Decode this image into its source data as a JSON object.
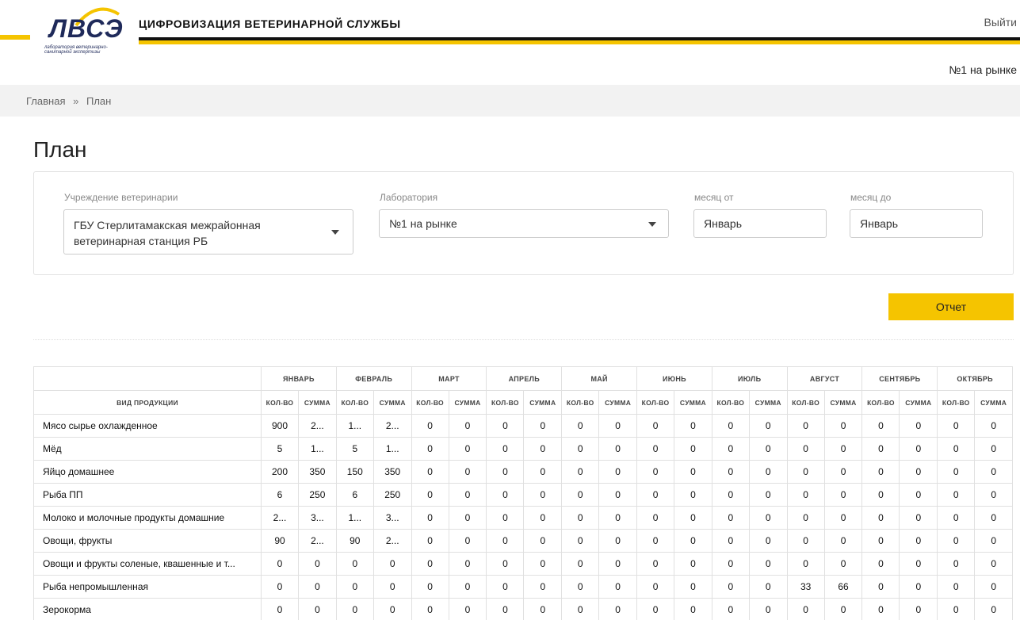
{
  "header": {
    "logo_text": "ЛВСЭ",
    "logo_subtitle": "лаборатория ветеринарно-санитарной экспертизы",
    "app_title": "ЦИФРОВИЗАЦИЯ ВЕТЕРИНАРНОЙ СЛУЖБЫ",
    "logout_label": "Выйти",
    "lab_name": "№1 на рынке",
    "accent_color": "#f5c400",
    "logo_color": "#1f2a5a"
  },
  "breadcrumb": {
    "home": "Главная",
    "separator": "»",
    "current": "План"
  },
  "page_title": "План",
  "filters": {
    "institution": {
      "label": "Учреждение ветеринарии",
      "value": "ГБУ Стерлитамакская межрайонная ветеринарная станция РБ"
    },
    "laboratory": {
      "label": "Лаборатория",
      "value": "№1 на рынке"
    },
    "month_from": {
      "label": "месяц от",
      "value": "Январь"
    },
    "month_to": {
      "label": "месяц до",
      "value": "Январь"
    }
  },
  "report_button": "Отчет",
  "table": {
    "product_header": "ВИД ПРОДУКЦИИ",
    "qty_header": "КОЛ-ВО",
    "sum_header": "СУММА",
    "months": [
      "ЯНВАРЬ",
      "ФЕВРАЛЬ",
      "МАРТ",
      "АПРЕЛЬ",
      "МАЙ",
      "ИЮНЬ",
      "ИЮЛЬ",
      "АВГУСТ",
      "СЕНТЯБРЬ",
      "ОКТЯБРЬ"
    ],
    "rows": [
      {
        "name": "Мясо сырье охлажденное",
        "values": [
          "900",
          "2...",
          "1...",
          "2...",
          "0",
          "0",
          "0",
          "0",
          "0",
          "0",
          "0",
          "0",
          "0",
          "0",
          "0",
          "0",
          "0",
          "0",
          "0",
          "0"
        ]
      },
      {
        "name": "Мёд",
        "values": [
          "5",
          "1...",
          "5",
          "1...",
          "0",
          "0",
          "0",
          "0",
          "0",
          "0",
          "0",
          "0",
          "0",
          "0",
          "0",
          "0",
          "0",
          "0",
          "0",
          "0"
        ]
      },
      {
        "name": "Яйцо домашнее",
        "values": [
          "200",
          "350",
          "150",
          "350",
          "0",
          "0",
          "0",
          "0",
          "0",
          "0",
          "0",
          "0",
          "0",
          "0",
          "0",
          "0",
          "0",
          "0",
          "0",
          "0"
        ]
      },
      {
        "name": "Рыба ПП",
        "values": [
          "6",
          "250",
          "6",
          "250",
          "0",
          "0",
          "0",
          "0",
          "0",
          "0",
          "0",
          "0",
          "0",
          "0",
          "0",
          "0",
          "0",
          "0",
          "0",
          "0"
        ]
      },
      {
        "name": "Молоко и молочные продукты домашние",
        "values": [
          "2...",
          "3...",
          "1...",
          "3...",
          "0",
          "0",
          "0",
          "0",
          "0",
          "0",
          "0",
          "0",
          "0",
          "0",
          "0",
          "0",
          "0",
          "0",
          "0",
          "0"
        ]
      },
      {
        "name": "Овощи, фрукты",
        "values": [
          "90",
          "2...",
          "90",
          "2...",
          "0",
          "0",
          "0",
          "0",
          "0",
          "0",
          "0",
          "0",
          "0",
          "0",
          "0",
          "0",
          "0",
          "0",
          "0",
          "0"
        ]
      },
      {
        "name": "Овощи и фрукты соленые, квашенные и т...",
        "values": [
          "0",
          "0",
          "0",
          "0",
          "0",
          "0",
          "0",
          "0",
          "0",
          "0",
          "0",
          "0",
          "0",
          "0",
          "0",
          "0",
          "0",
          "0",
          "0",
          "0"
        ]
      },
      {
        "name": "Рыба непромышленная",
        "values": [
          "0",
          "0",
          "0",
          "0",
          "0",
          "0",
          "0",
          "0",
          "0",
          "0",
          "0",
          "0",
          "0",
          "0",
          "33",
          "66",
          "0",
          "0",
          "0",
          "0"
        ]
      },
      {
        "name": "Зерокорма",
        "values": [
          "0",
          "0",
          "0",
          "0",
          "0",
          "0",
          "0",
          "0",
          "0",
          "0",
          "0",
          "0",
          "0",
          "0",
          "0",
          "0",
          "0",
          "0",
          "0",
          "0"
        ]
      }
    ]
  }
}
